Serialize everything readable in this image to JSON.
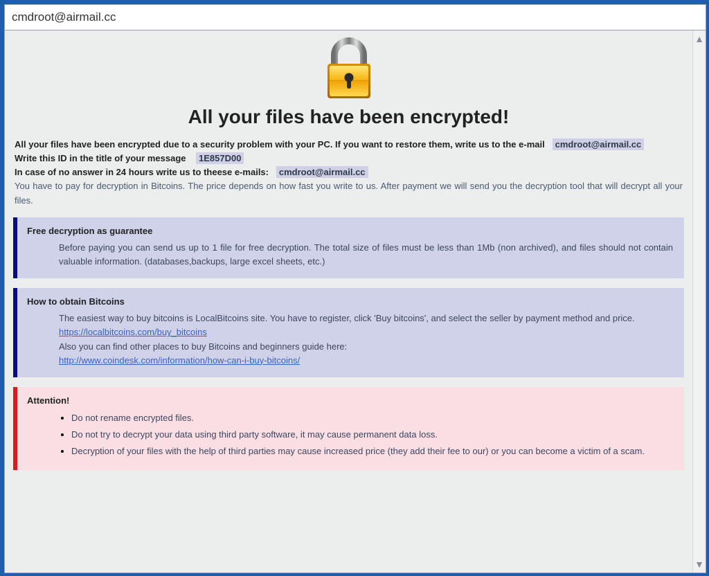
{
  "window": {
    "title": "cmdroot@airmail.cc"
  },
  "heading": "All your files have been encrypted!",
  "intro": {
    "line1_prefix": "All your files have been encrypted due to a security problem with your PC. If you want to restore them, write us to the e-mail",
    "email1": "cmdroot@airmail.cc",
    "line2_prefix": "Write this ID in the title of your message",
    "id_value": "1E857D00",
    "line3_prefix": "In case of no answer in 24 hours write us to theese e-mails:",
    "email2": "cmdroot@airmail.cc",
    "payline": "You have to pay for decryption in Bitcoins. The price depends on how fast you write to us. After payment we will send you the decryption tool that will decrypt all your files."
  },
  "guarantee": {
    "title": "Free decryption as guarantee",
    "body": "Before paying you can send us up to 1 file for free decryption. The total size of files must be less than 1Mb (non archived), and files should not contain valuable information. (databases,backups, large excel sheets, etc.)"
  },
  "obtain": {
    "title": "How to obtain Bitcoins",
    "line1": "The easiest way to buy bitcoins is LocalBitcoins site. You have to register, click 'Buy bitcoins', and select the seller by payment method and price.",
    "link1": "https://localbitcoins.com/buy_bitcoins",
    "line2": "Also you can find other places to buy Bitcoins and beginners guide here:",
    "link2": "http://www.coindesk.com/information/how-can-i-buy-bitcoins/"
  },
  "attention": {
    "title": "Attention!",
    "items": [
      "Do not rename encrypted files.",
      "Do not try to decrypt your data using third party software, it may cause permanent data loss.",
      "Decryption of your files with the help of third parties may cause increased price (they add their fee to our) or you can become a victim of a scam."
    ]
  }
}
